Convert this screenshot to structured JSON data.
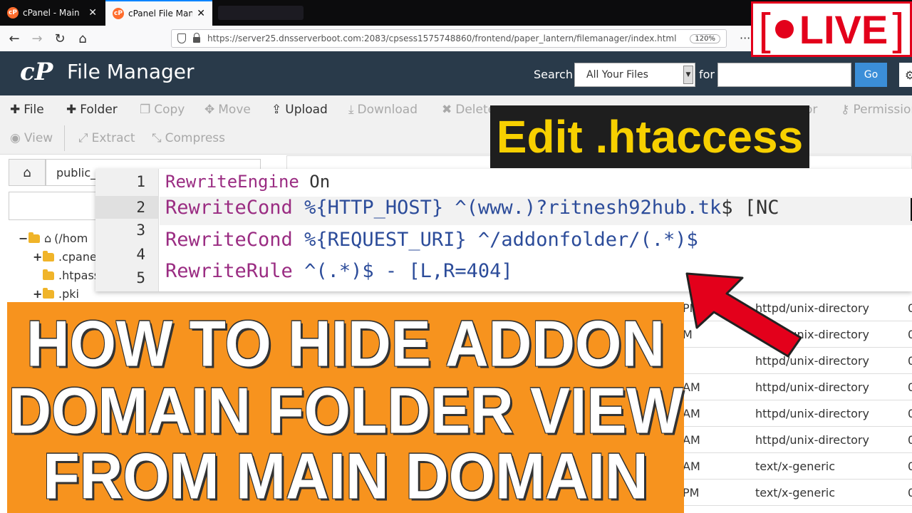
{
  "browser": {
    "tabs": [
      {
        "label": "cPanel - Main",
        "active": false
      },
      {
        "label": "cPanel File Mana",
        "active": true
      }
    ],
    "url": "https://server25.dnsserverboot.com:2083/cpsess1575748860/frontend/paper_lantern/filemanager/index.html",
    "zoom": "120%",
    "more": "···"
  },
  "header": {
    "logo": "cP",
    "title": "File Manager",
    "search_label": "Search",
    "search_scope": "All Your Files",
    "for_label": "for",
    "go_label": "Go",
    "accent": "#293a4a"
  },
  "toolbar": {
    "file": "File",
    "folder": "Folder",
    "copy": "Copy",
    "move": "Move",
    "upload": "Upload",
    "download": "Download",
    "delete": "Delete",
    "restore": "or",
    "permissions": "Permissions",
    "view": "View",
    "extract": "Extract",
    "compress": "Compress"
  },
  "left": {
    "path": "public_",
    "tree": [
      {
        "label": "(/hom",
        "toggle": "−"
      },
      {
        "label": ".cpane",
        "toggle": "+"
      },
      {
        "label": ".htpass",
        "toggle": ""
      },
      {
        "label": ".pki",
        "toggle": "+"
      }
    ]
  },
  "files": [
    {
      "time": "PM",
      "type": "httpd/unix-directory",
      "perm": "0"
    },
    {
      "time": "M",
      "type": "httpd/unix-directory",
      "perm": "0"
    },
    {
      "time": "",
      "type": "httpd/unix-directory",
      "perm": "0"
    },
    {
      "time": "AM",
      "type": "httpd/unix-directory",
      "perm": "0"
    },
    {
      "time": "AM",
      "type": "httpd/unix-directory",
      "perm": "0"
    },
    {
      "time": "AM",
      "type": "httpd/unix-directory",
      "perm": "0"
    },
    {
      "time": "AM",
      "type": "text/x-generic",
      "perm": "0"
    },
    {
      "time": "PM",
      "type": "text/x-generic",
      "perm": "0"
    }
  ],
  "editor": {
    "line_numbers": [
      "1",
      "2",
      "3",
      "4",
      "5"
    ],
    "line1": {
      "kw": "RewriteEngine",
      "rest": " On"
    },
    "line2": {
      "kw": "RewriteCond",
      "var": " %{HTTP_HOST}",
      "rest": " ^(www.)?ritnesh92hub.tk",
      "tail": "$ [NC"
    },
    "line3": {
      "kw": "RewriteCond",
      "var": " %{REQUEST_URI}",
      "rest": " ^/addonfolder/(.*)$"
    },
    "line4": {
      "kw": "RewriteRule",
      "rest": " ^(.*)$ - [L,R=404]"
    }
  },
  "overlay": {
    "edit_banner": "Edit .htaccess",
    "live": "LIVE",
    "title_lines": [
      "HOW TO HIDE ADDON",
      "DOMAIN FOLDER VIEW",
      "FROM MAIN DOMAIN"
    ],
    "title_bg": "#f7931e",
    "banner_color": "#f7d000",
    "live_color": "#e3001b"
  }
}
